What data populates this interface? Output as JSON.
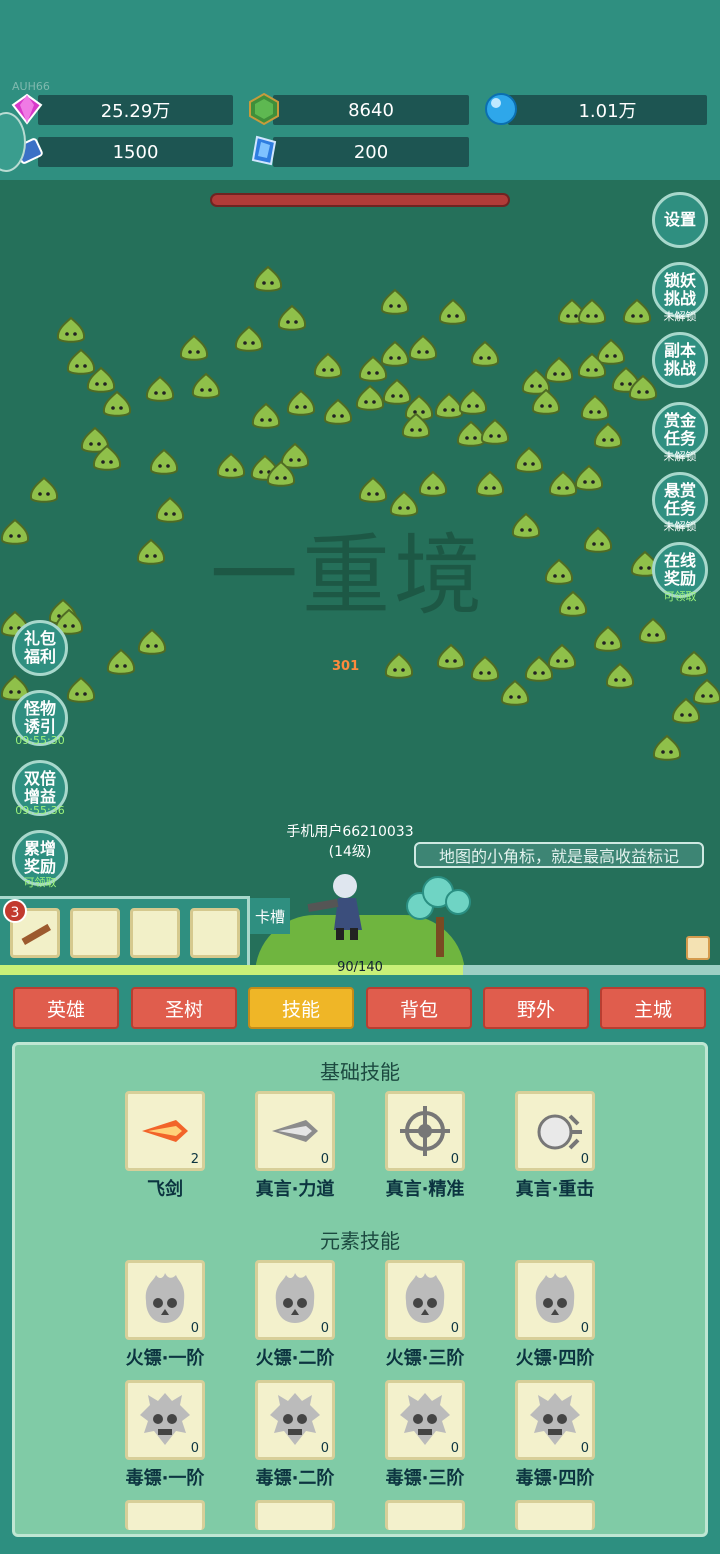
{
  "header": {
    "uid": "AUH66",
    "resources": [
      {
        "icon": "gem-icon",
        "value": "25.29万"
      },
      {
        "icon": "shield-icon",
        "value": "8640"
      },
      {
        "icon": "orb-icon",
        "value": "1.01万"
      },
      {
        "icon": "scroll-icon",
        "value": "1500"
      },
      {
        "icon": "crystal-icon",
        "value": "200"
      }
    ]
  },
  "right_buttons": [
    {
      "label": "设置",
      "sub": ""
    },
    {
      "label": "锁妖挑战",
      "sub": "未解锁"
    },
    {
      "label": "副本挑战",
      "sub": ""
    },
    {
      "label": "赏金任务",
      "sub": "未解锁"
    },
    {
      "label": "悬赏任务",
      "sub": "未解锁"
    },
    {
      "label": "在线奖励",
      "sub": "可领取"
    }
  ],
  "left_buttons": [
    {
      "label": "礼包福利",
      "sub": ""
    },
    {
      "label": "怪物诱引",
      "sub": "09:55:30"
    },
    {
      "label": "双倍增益",
      "sub": "09:55:36"
    },
    {
      "label": "累增奖励",
      "sub": "可领取"
    }
  ],
  "field": {
    "watermark": "一重境",
    "damage": "301",
    "player_name": "手机用户66210033",
    "player_level": "(14级)",
    "hint": "地图的小角标，就是最高收益标记"
  },
  "skillbar": {
    "count": "3",
    "card_slot": "卡槽",
    "xp_text": "90/140",
    "xp_ratio": 0.643
  },
  "tabs": [
    {
      "label": "英雄",
      "active": false
    },
    {
      "label": "圣树",
      "active": false
    },
    {
      "label": "技能",
      "active": true
    },
    {
      "label": "背包",
      "active": false
    },
    {
      "label": "野外",
      "active": false
    },
    {
      "label": "主城",
      "active": false
    }
  ],
  "skills": {
    "basic_title": "基础技能",
    "basic": [
      {
        "name": "飞剑",
        "level": "2",
        "icon": "flying-sword-icon"
      },
      {
        "name": "真言·力道",
        "level": "0",
        "icon": "arrow-icon"
      },
      {
        "name": "真言·精准",
        "level": "0",
        "icon": "crosshair-icon"
      },
      {
        "name": "真言·重击",
        "level": "0",
        "icon": "fist-icon"
      }
    ],
    "element_title": "元素技能",
    "element_rows": [
      [
        {
          "name": "火镖·一阶",
          "level": "0",
          "icon": "fire-skull-icon"
        },
        {
          "name": "火镖·二阶",
          "level": "0",
          "icon": "fire-skull-icon"
        },
        {
          "name": "火镖·三阶",
          "level": "0",
          "icon": "fire-skull-icon"
        },
        {
          "name": "火镖·四阶",
          "level": "0",
          "icon": "fire-skull-icon"
        }
      ],
      [
        {
          "name": "毒镖·一阶",
          "level": "0",
          "icon": "poison-skull-icon"
        },
        {
          "name": "毒镖·二阶",
          "level": "0",
          "icon": "poison-skull-icon"
        },
        {
          "name": "毒镖·三阶",
          "level": "0",
          "icon": "poison-skull-icon"
        },
        {
          "name": "毒镖·四阶",
          "level": "0",
          "icon": "poison-skull-icon"
        }
      ]
    ]
  },
  "colors": {
    "tab": "#e05d4d",
    "tab_active": "#efb627",
    "panel": "#80cba6",
    "field": "#25705a"
  }
}
